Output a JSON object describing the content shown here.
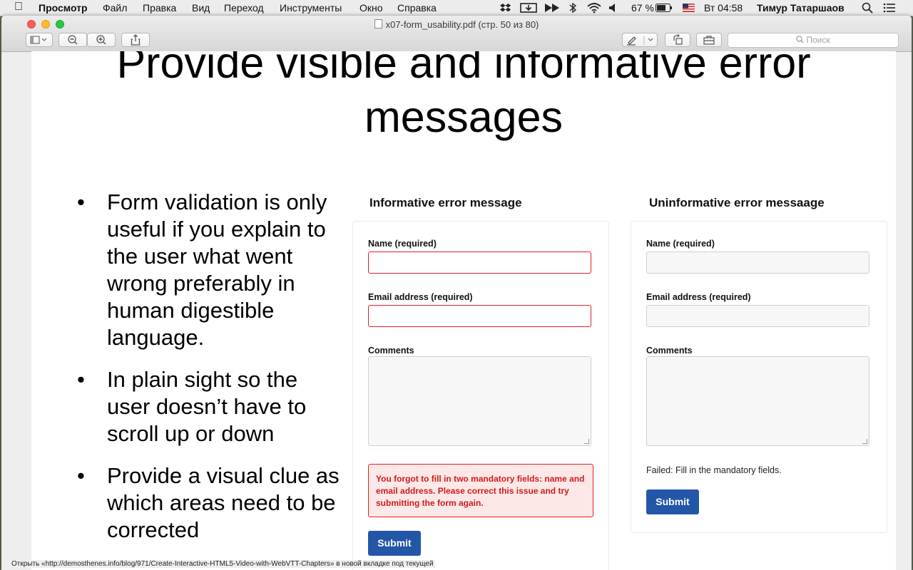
{
  "menubar": {
    "apple": "",
    "app": "Просмотр",
    "items": [
      "Файл",
      "Правка",
      "Вид",
      "Переход",
      "Инструменты",
      "Окно",
      "Справка"
    ],
    "battery": "67 %",
    "clock": "Вт 04:58",
    "user": "Тимур Татаршаов"
  },
  "window": {
    "title": "x07-form_usability.pdf (стр. 50 из 80)",
    "search_placeholder": "Поиск"
  },
  "slide": {
    "title_line1": "Provide visible and informative error",
    "title_line2": "messages",
    "bullets": [
      "Form validation is only useful if you explain to the user what went wrong preferably in human digestible language.",
      "In plain sight so the user doesn’t have to scroll up or down",
      "Provide a visual clue as which areas need to be corrected"
    ]
  },
  "form_good": {
    "heading": "Informative error message",
    "name_label": "Name (required)",
    "email_label": "Email address (required)",
    "comments_label": "Comments",
    "error_text": "You forgot to fill in two mandatory fields: name and email address. Please correct this issue and try submitting the form again.",
    "submit": "Submit"
  },
  "form_bad": {
    "heading": "Uninformative error messaage",
    "name_label": "Name (required)",
    "email_label": "Email address (required)",
    "comments_label": "Comments",
    "error_text": "Failed: Fill in the mandatory fields.",
    "submit": "Submit"
  },
  "status_text": "Открыть «http://demosthenes.info/blog/971/Create-Interactive-HTML5-Video-with-WebVTT-Chapters» в новой вкладке под текущей",
  "colors": {
    "error_red": "#e02020",
    "submit_blue": "#2456a8"
  }
}
